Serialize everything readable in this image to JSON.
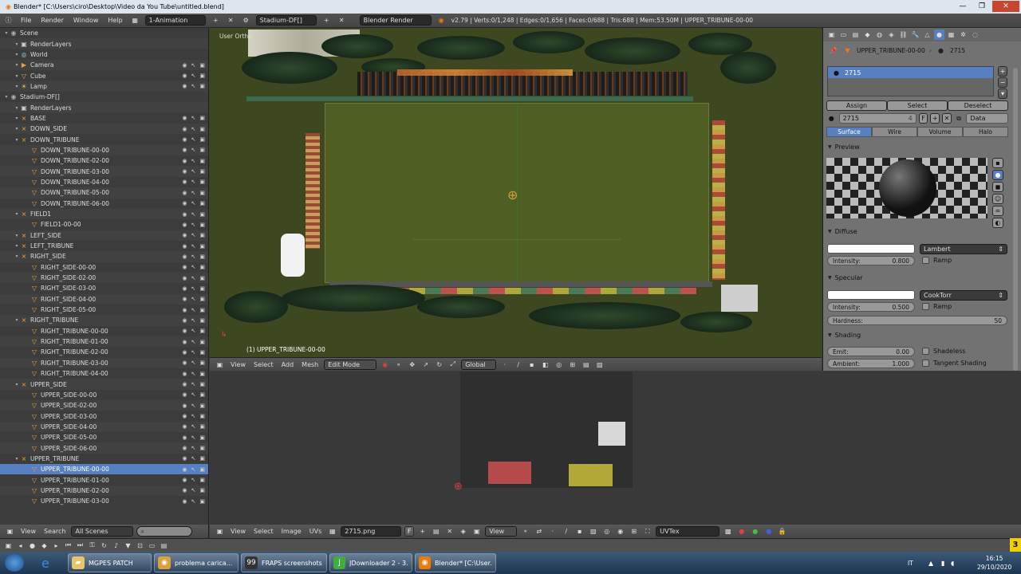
{
  "window": {
    "title": "Blender* [C:\\Users\\ciro\\Desktop\\Video da You Tube\\untitled.blend]"
  },
  "info_header": {
    "menus": [
      "File",
      "Render",
      "Window",
      "Help"
    ],
    "screen_layout": "1-Animation",
    "scene": "Stadium-DF[]",
    "engine": "Blender Render",
    "stats": "v2.79 | Verts:0/1,248 | Edges:0/1,656 | Faces:0/688 | Tris:688 | Mem:53.50M | UPPER_TRIBUNE-00-00"
  },
  "outliner": {
    "rows": [
      {
        "label": "Scene",
        "level": 0,
        "icon": "scene-icon",
        "vis": false
      },
      {
        "label": "RenderLayers",
        "level": 1,
        "icon": "render-layers-icon",
        "vis": false
      },
      {
        "label": "World",
        "level": 1,
        "icon": "world-icon",
        "vis": false
      },
      {
        "label": "Camera",
        "level": 1,
        "icon": "camera-icon",
        "vis": true
      },
      {
        "label": "Cube",
        "level": 1,
        "icon": "mesh-icon",
        "vis": true
      },
      {
        "label": "Lamp",
        "level": 1,
        "icon": "lamp-icon",
        "vis": true
      },
      {
        "label": "Stadium-DF[]",
        "level": 0,
        "icon": "scene-icon",
        "vis": false
      },
      {
        "label": "RenderLayers",
        "level": 1,
        "icon": "render-layers-icon",
        "vis": false
      },
      {
        "label": "BASE",
        "level": 1,
        "icon": "empty-icon",
        "vis": true
      },
      {
        "label": "DOWN_SIDE",
        "level": 1,
        "icon": "empty-icon",
        "vis": true
      },
      {
        "label": "DOWN_TRIBUNE",
        "level": 1,
        "icon": "empty-icon",
        "vis": true
      },
      {
        "label": "DOWN_TRIBUNE-00-00",
        "level": 2,
        "icon": "mesh-icon",
        "vis": true
      },
      {
        "label": "DOWN_TRIBUNE-02-00",
        "level": 2,
        "icon": "mesh-icon",
        "vis": true
      },
      {
        "label": "DOWN_TRIBUNE-03-00",
        "level": 2,
        "icon": "mesh-icon",
        "vis": true
      },
      {
        "label": "DOWN_TRIBUNE-04-00",
        "level": 2,
        "icon": "mesh-icon",
        "vis": true
      },
      {
        "label": "DOWN_TRIBUNE-05-00",
        "level": 2,
        "icon": "mesh-icon",
        "vis": true
      },
      {
        "label": "DOWN_TRIBUNE-06-00",
        "level": 2,
        "icon": "mesh-icon",
        "vis": true
      },
      {
        "label": "FIELD1",
        "level": 1,
        "icon": "empty-icon",
        "vis": true
      },
      {
        "label": "FIELD1-00-00",
        "level": 2,
        "icon": "mesh-icon",
        "vis": true
      },
      {
        "label": "LEFT_SIDE",
        "level": 1,
        "icon": "empty-icon",
        "vis": true
      },
      {
        "label": "LEFT_TRIBUNE",
        "level": 1,
        "icon": "empty-icon",
        "vis": true
      },
      {
        "label": "RIGHT_SIDE",
        "level": 1,
        "icon": "empty-icon",
        "vis": true
      },
      {
        "label": "RIGHT_SIDE-00-00",
        "level": 2,
        "icon": "mesh-icon",
        "vis": true
      },
      {
        "label": "RIGHT_SIDE-02-00",
        "level": 2,
        "icon": "mesh-icon",
        "vis": true
      },
      {
        "label": "RIGHT_SIDE-03-00",
        "level": 2,
        "icon": "mesh-icon",
        "vis": true
      },
      {
        "label": "RIGHT_SIDE-04-00",
        "level": 2,
        "icon": "mesh-icon",
        "vis": true
      },
      {
        "label": "RIGHT_SIDE-05-00",
        "level": 2,
        "icon": "mesh-icon",
        "vis": true
      },
      {
        "label": "RIGHT_TRIBUNE",
        "level": 1,
        "icon": "empty-icon",
        "vis": true
      },
      {
        "label": "RIGHT_TRIBUNE-00-00",
        "level": 2,
        "icon": "mesh-icon",
        "vis": true
      },
      {
        "label": "RIGHT_TRIBUNE-01-00",
        "level": 2,
        "icon": "mesh-icon",
        "vis": true
      },
      {
        "label": "RIGHT_TRIBUNE-02-00",
        "level": 2,
        "icon": "mesh-icon",
        "vis": true
      },
      {
        "label": "RIGHT_TRIBUNE-03-00",
        "level": 2,
        "icon": "mesh-icon",
        "vis": true
      },
      {
        "label": "RIGHT_TRIBUNE-04-00",
        "level": 2,
        "icon": "mesh-icon",
        "vis": true
      },
      {
        "label": "UPPER_SIDE",
        "level": 1,
        "icon": "empty-icon",
        "vis": true
      },
      {
        "label": "UPPER_SIDE-00-00",
        "level": 2,
        "icon": "mesh-icon",
        "vis": true
      },
      {
        "label": "UPPER_SIDE-02-00",
        "level": 2,
        "icon": "mesh-icon",
        "vis": true
      },
      {
        "label": "UPPER_SIDE-03-00",
        "level": 2,
        "icon": "mesh-icon",
        "vis": true
      },
      {
        "label": "UPPER_SIDE-04-00",
        "level": 2,
        "icon": "mesh-icon",
        "vis": true
      },
      {
        "label": "UPPER_SIDE-05-00",
        "level": 2,
        "icon": "mesh-icon",
        "vis": true
      },
      {
        "label": "UPPER_SIDE-06-00",
        "level": 2,
        "icon": "mesh-icon",
        "vis": true
      },
      {
        "label": "UPPER_TRIBUNE",
        "level": 1,
        "icon": "empty-icon",
        "vis": true
      },
      {
        "label": "UPPER_TRIBUNE-00-00",
        "level": 2,
        "icon": "mesh-icon",
        "vis": true,
        "selected": true
      },
      {
        "label": "UPPER_TRIBUNE-01-00",
        "level": 2,
        "icon": "mesh-icon",
        "vis": true
      },
      {
        "label": "UPPER_TRIBUNE-02-00",
        "level": 2,
        "icon": "mesh-icon",
        "vis": true
      },
      {
        "label": "UPPER_TRIBUNE-03-00",
        "level": 2,
        "icon": "mesh-icon",
        "vis": true
      }
    ],
    "footer": {
      "view": "View",
      "search": "Search",
      "filter": "All Scenes"
    }
  },
  "viewport": {
    "view_name": "User Ortho",
    "object_label": "(1) UPPER_TRIBUNE-00-00",
    "header": {
      "view": "View",
      "select": "Select",
      "add": "Add",
      "mesh": "Mesh",
      "mode": "Edit Mode",
      "orientation": "Global"
    }
  },
  "properties": {
    "breadcrumb_object": "UPPER_TRIBUNE-00-00",
    "breadcrumb_material": "2715",
    "slot_name": "2715",
    "buttons": {
      "assign": "Assign",
      "select": "Select",
      "deselect": "Deselect"
    },
    "material_field": "2715",
    "users": "4",
    "fake_user": "F",
    "link": "Data",
    "tabs": [
      "Surface",
      "Wire",
      "Volume",
      "Halo"
    ],
    "sections": {
      "preview": "Preview",
      "diffuse": "Diffuse",
      "specular": "Specular",
      "shading": "Shading"
    },
    "diffuse": {
      "shader": "Lambert",
      "intensity_label": "Intensity:",
      "intensity": "0.800",
      "ramp": "Ramp"
    },
    "specular": {
      "shader": "CookTorr",
      "intensity_label": "Intensity:",
      "intensity": "0.500",
      "ramp": "Ramp",
      "hardness_label": "Hardness:",
      "hardness": "50"
    },
    "shading": {
      "emit_label": "Emit:",
      "emit": "0.00",
      "shadeless": "Shadeless",
      "ambient_label": "Ambient:",
      "ambient": "1.000",
      "tangent": "Tangent Shading"
    }
  },
  "uv_editor": {
    "header": {
      "view": "View",
      "select": "Select",
      "image": "Image",
      "uvs": "UVs",
      "image_name": "2715.png",
      "fake": "F",
      "view2": "View",
      "uvmap": "UVTex"
    }
  },
  "taskbar": {
    "tasks": [
      {
        "label": "MGPES PATCH",
        "icon": "folder-icon",
        "color": "#e8c46a"
      },
      {
        "label": "problema carica...",
        "icon": "chrome-icon",
        "color": "#d9a23c"
      },
      {
        "label": "FRAPS screenshots",
        "icon": "fraps-icon",
        "color": "#333333"
      },
      {
        "label": "JDownloader 2 - 3...",
        "icon": "jdownloader-icon",
        "color": "#3fae3f"
      },
      {
        "label": "Blender* [C:\\User...",
        "icon": "blender-icon",
        "color": "#e87d0d"
      }
    ],
    "lang": "IT",
    "time": "16:15",
    "date": "29/10/2020"
  }
}
